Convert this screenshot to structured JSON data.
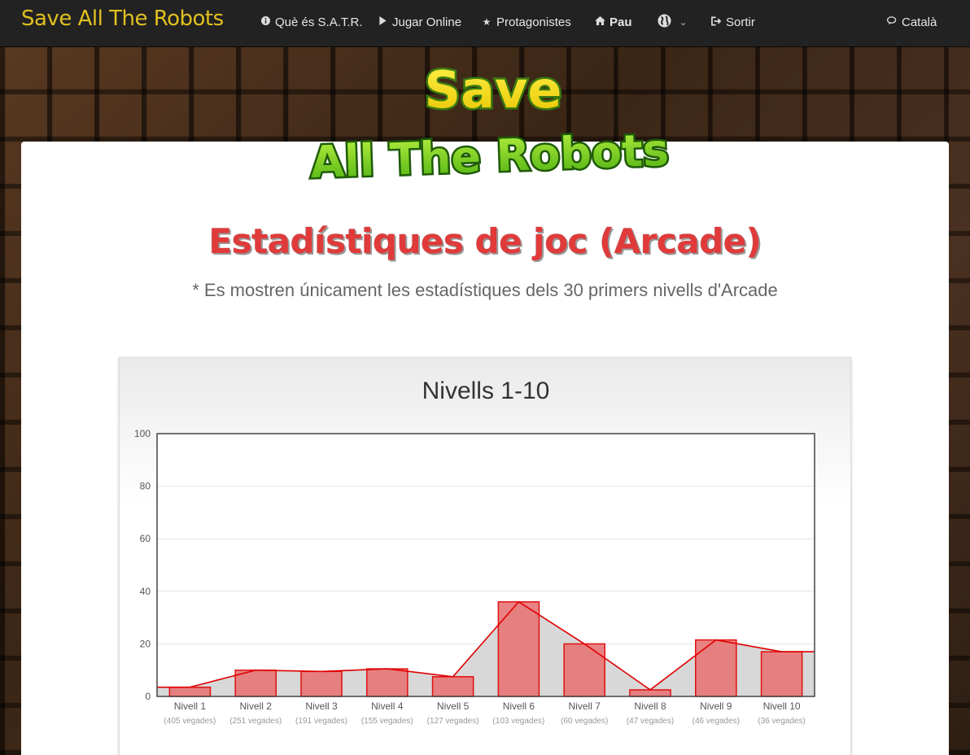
{
  "navbar": {
    "brand": "Save All The Robots",
    "items": [
      {
        "icon": "info-circle-icon",
        "label": "Què és S.A.T.R."
      },
      {
        "icon": "play-icon",
        "label": "Jugar Online"
      },
      {
        "icon": "star-icon",
        "label": "Protagonistes"
      },
      {
        "icon": "home-icon",
        "label": "Pau"
      },
      {
        "icon": "globe-icon",
        "label": ""
      },
      {
        "icon": "sign-out-icon",
        "label": "Sortir"
      }
    ],
    "language": {
      "icon": "comments-icon",
      "label": "Català"
    }
  },
  "logo": {
    "line1": "Save",
    "line2": "All The Robots"
  },
  "page": {
    "title": "Estadístiques de joc (Arcade)",
    "subtitle": "* Es mostren únicament les estadístiques dels 30 primers nivells d'Arcade"
  },
  "colors": {
    "bar_fill": "#e87878",
    "bar_stroke": "#e00000",
    "area_fill": "#d6d6d6",
    "title_red": "#e03a3a"
  },
  "chart_data": {
    "type": "bar",
    "title": "Nivells 1-10",
    "categories": [
      "Nivell 1",
      "Nivell 2",
      "Nivell 3",
      "Nivell 4",
      "Nivell 5",
      "Nivell 6",
      "Nivell 7",
      "Nivell 8",
      "Nivell 9",
      "Nivell 10"
    ],
    "sublabels": [
      "(405 vegades)",
      "(251 vegades)",
      "(191 vegades)",
      "(155 vegades)",
      "(127 vegades)",
      "(103 vegades)",
      "(60 vegades)",
      "(47 vegades)",
      "(46 vegades)",
      "(36 vegades)"
    ],
    "values": [
      3.5,
      10,
      9.5,
      10.5,
      7.5,
      36,
      20,
      2.5,
      21.5,
      17
    ],
    "ylim": [
      0,
      100
    ],
    "yticks": [
      "0",
      "20",
      "40",
      "60",
      "80",
      "100"
    ],
    "overlay": "line-area",
    "grid": true
  }
}
